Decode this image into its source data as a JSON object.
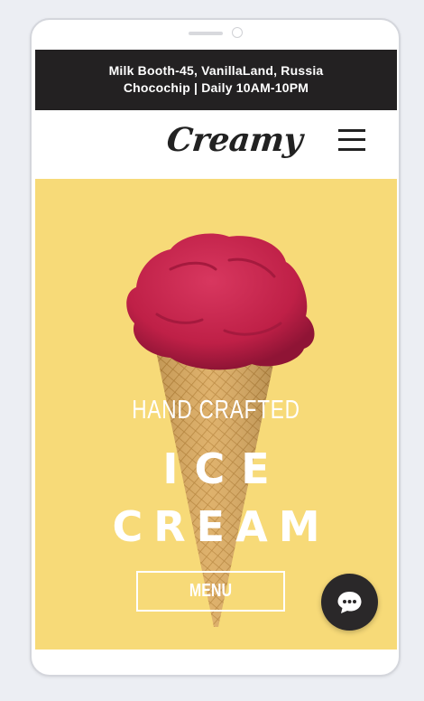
{
  "topbar": {
    "address": "Milk Booth-45, VanillaLand, Russia",
    "hours": "Chocochip |  Daily 10AM-10PM"
  },
  "header": {
    "logo": "Creamy",
    "menu_icon": "hamburger-icon"
  },
  "hero": {
    "subtitle": "HAND CRAFTED",
    "title_line1": "ICE",
    "title_line2": "CREAM",
    "button_label": "MENU",
    "image": "ice-cream-cone-image"
  },
  "chat": {
    "icon": "chat-bubble-icon"
  },
  "colors": {
    "topbar_bg": "#232122",
    "hero_bg": "#f7da78",
    "scoop": "#c8284f",
    "cone": "#d9a75c",
    "chat_bg": "#2a2829"
  }
}
